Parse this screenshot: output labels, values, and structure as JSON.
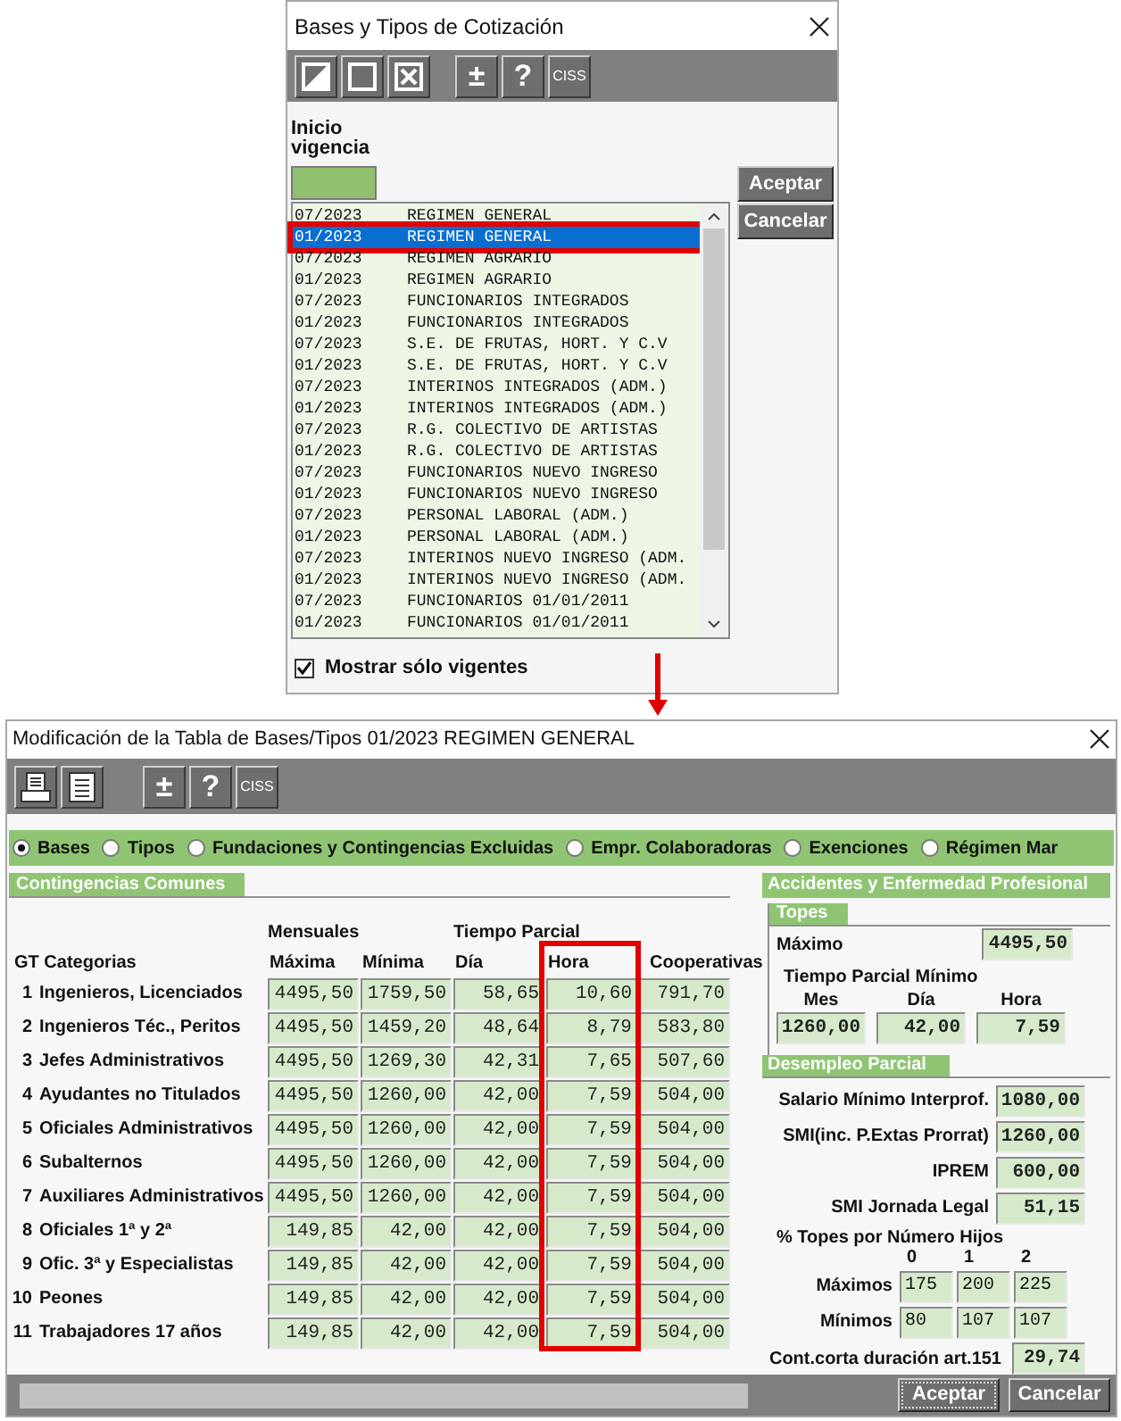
{
  "top_dialog": {
    "title": "Bases y Tipos de Cotización",
    "toolbar": [
      [
        {
          "kind": "half"
        },
        {
          "kind": "square"
        },
        {
          "kind": "cross"
        }
      ],
      [
        {
          "kind": "text",
          "label": "±"
        },
        {
          "kind": "text",
          "label": "?"
        },
        {
          "kind": "text",
          "label": "CISS"
        }
      ]
    ],
    "field_label": "Inicio vigencia",
    "rows": [
      {
        "date": "07/2023",
        "name": "REGIMEN GENERAL",
        "selected": false
      },
      {
        "date": "01/2023",
        "name": "REGIMEN GENERAL",
        "selected": true
      },
      {
        "date": "07/2023",
        "name": "REGIMEN AGRARIO",
        "selected": false
      },
      {
        "date": "01/2023",
        "name": "REGIMEN AGRARIO",
        "selected": false
      },
      {
        "date": "07/2023",
        "name": "FUNCIONARIOS INTEGRADOS",
        "selected": false
      },
      {
        "date": "01/2023",
        "name": "FUNCIONARIOS INTEGRADOS",
        "selected": false
      },
      {
        "date": "07/2023",
        "name": "S.E. DE FRUTAS, HORT. Y C.V",
        "selected": false
      },
      {
        "date": "01/2023",
        "name": "S.E. DE FRUTAS, HORT. Y C.V",
        "selected": false
      },
      {
        "date": "07/2023",
        "name": "INTERINOS INTEGRADOS (ADM.)",
        "selected": false
      },
      {
        "date": "01/2023",
        "name": "INTERINOS INTEGRADOS (ADM.)",
        "selected": false
      },
      {
        "date": "07/2023",
        "name": "R.G. COLECTIVO DE ARTISTAS",
        "selected": false
      },
      {
        "date": "01/2023",
        "name": "R.G. COLECTIVO DE ARTISTAS",
        "selected": false
      },
      {
        "date": "07/2023",
        "name": "FUNCIONARIOS NUEVO INGRESO",
        "selected": false
      },
      {
        "date": "01/2023",
        "name": "FUNCIONARIOS NUEVO INGRESO",
        "selected": false
      },
      {
        "date": "07/2023",
        "name": "PERSONAL LABORAL (ADM.)",
        "selected": false
      },
      {
        "date": "01/2023",
        "name": "PERSONAL LABORAL (ADM.)",
        "selected": false
      },
      {
        "date": "07/2023",
        "name": "INTERINOS NUEVO INGRESO (ADM.",
        "selected": false
      },
      {
        "date": "01/2023",
        "name": "INTERINOS NUEVO INGRESO (ADM.",
        "selected": false
      },
      {
        "date": "07/2023",
        "name": "FUNCIONARIOS 01/01/2011",
        "selected": false
      },
      {
        "date": "01/2023",
        "name": "FUNCIONARIOS 01/01/2011",
        "selected": false
      }
    ],
    "buttons": [
      "Aceptar",
      "Cancelar"
    ],
    "checkbox": {
      "label": "Mostrar sólo vigentes",
      "checked": true
    }
  },
  "main_window": {
    "title": "Modificación de la Tabla de Bases/Tipos 01/2023 REGIMEN GENERAL",
    "toolbar": [
      [
        {
          "kind": "printer"
        },
        {
          "kind": "document"
        }
      ],
      [
        {
          "kind": "text",
          "label": "±"
        },
        {
          "kind": "text",
          "label": "?"
        },
        {
          "kind": "text",
          "label": "CISS"
        }
      ]
    ],
    "options": [
      {
        "label": "Bases",
        "selected": true
      },
      {
        "label": "Tipos",
        "selected": false
      },
      {
        "label": "Fundaciones y Contingencias Excluidas",
        "selected": false
      },
      {
        "label": "Empr. Colaboradoras",
        "selected": false
      },
      {
        "label": "Exenciones",
        "selected": false
      },
      {
        "label": "Régimen Mar",
        "selected": false
      }
    ],
    "contingencias": {
      "title": "Contingencias Comunes",
      "group_headers": [
        "Mensuales",
        "Tiempo Parcial"
      ],
      "columns": [
        "GT Categorias",
        "Máxima",
        "Mínima",
        "Día",
        "Hora",
        "Cooperativas"
      ],
      "rows": [
        {
          "number": "1",
          "name": "Ingenieros, Licenciados",
          "values": [
            "4495,50",
            "1759,50",
            "58,65",
            "10,60",
            "791,70"
          ]
        },
        {
          "number": "2",
          "name": "Ingenieros Téc., Peritos",
          "values": [
            "4495,50",
            "1459,20",
            "48,64",
            "8,79",
            "583,80"
          ]
        },
        {
          "number": "3",
          "name": "Jefes Administrativos",
          "values": [
            "4495,50",
            "1269,30",
            "42,31",
            "7,65",
            "507,60"
          ]
        },
        {
          "number": "4",
          "name": "Ayudantes no Titulados",
          "values": [
            "4495,50",
            "1260,00",
            "42,00",
            "7,59",
            "504,00"
          ]
        },
        {
          "number": "5",
          "name": "Oficiales Administrativos",
          "values": [
            "4495,50",
            "1260,00",
            "42,00",
            "7,59",
            "504,00"
          ]
        },
        {
          "number": "6",
          "name": "Subalternos",
          "values": [
            "4495,50",
            "1260,00",
            "42,00",
            "7,59",
            "504,00"
          ]
        },
        {
          "number": "7",
          "name": "Auxiliares Administrativos",
          "values": [
            "4495,50",
            "1260,00",
            "42,00",
            "7,59",
            "504,00"
          ]
        },
        {
          "number": "8",
          "name": "Oficiales 1ª y 2ª",
          "values": [
            "149,85",
            "42,00",
            "42,00",
            "7,59",
            "504,00"
          ]
        },
        {
          "number": "9",
          "name": "Ofic. 3ª y Especialistas",
          "values": [
            "149,85",
            "42,00",
            "42,00",
            "7,59",
            "504,00"
          ]
        },
        {
          "number": "10",
          "name": "Peones",
          "values": [
            "149,85",
            "42,00",
            "42,00",
            "7,59",
            "504,00"
          ]
        },
        {
          "number": "11",
          "name": "Trabajadores 17 años",
          "values": [
            "149,85",
            "42,00",
            "42,00",
            "7,59",
            "504,00"
          ]
        }
      ]
    },
    "accidentes": {
      "title": "Accidentes y Enfermedad Profesional",
      "topes_title": "Topes",
      "maximo_label": "Máximo",
      "maximo_value": "4495,50",
      "partial_label": "Tiempo Parcial Mínimo",
      "partial_columns": [
        "Mes",
        "Día",
        "Hora"
      ],
      "partial_values": [
        "1260,00",
        "42,00",
        "7,59"
      ]
    },
    "desempleo": {
      "title": "Desempleo Parcial",
      "fields": [
        {
          "label": "Salario Mínimo Interprof.",
          "value": "1080,00"
        },
        {
          "label": "SMI(inc. P.Extas Prorrat)",
          "value": "1260,00"
        },
        {
          "label": "IPREM",
          "value": "600,00"
        },
        {
          "label": "SMI Jornada Legal",
          "value": "51,15"
        }
      ],
      "hijos_title": "% Topes por Número Hijos",
      "hijos_columns": [
        "0",
        "1",
        "2"
      ],
      "hijos_rows": [
        {
          "label": "Máximos",
          "values": [
            "175",
            "200",
            "225"
          ]
        },
        {
          "label": "Mínimos",
          "values": [
            "80",
            "107",
            "107"
          ]
        }
      ]
    },
    "cont_corta": {
      "label": "Cont.corta duración art.151",
      "value": "29,74"
    },
    "buttons": [
      {
        "label": "Aceptar",
        "focused": true
      },
      {
        "label": "Cancelar",
        "focused": false
      }
    ]
  }
}
